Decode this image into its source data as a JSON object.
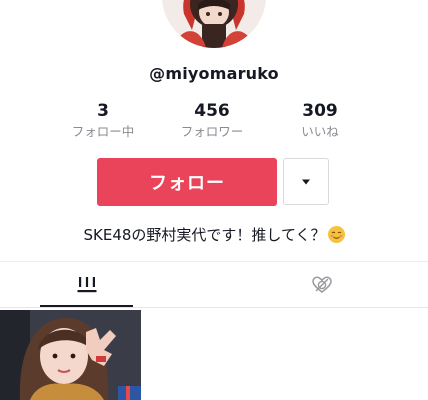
{
  "profile": {
    "username": "@miyomaruko",
    "bio": "SKE48の野村実代です！推してく？"
  },
  "stats": [
    {
      "value": "3",
      "label": "フォロー中"
    },
    {
      "value": "456",
      "label": "フォロワー"
    },
    {
      "value": "309",
      "label": "いいね"
    }
  ],
  "actions": {
    "follow_label": "フォロー",
    "more_icon": "caret-down-icon"
  },
  "tabs": [
    {
      "icon": "grid-icon",
      "active": true
    },
    {
      "icon": "liked-videos-hidden-icon",
      "active": false
    }
  ],
  "colors": {
    "accent": "#ea445a",
    "text": "#161823",
    "muted": "#8a8b91"
  }
}
